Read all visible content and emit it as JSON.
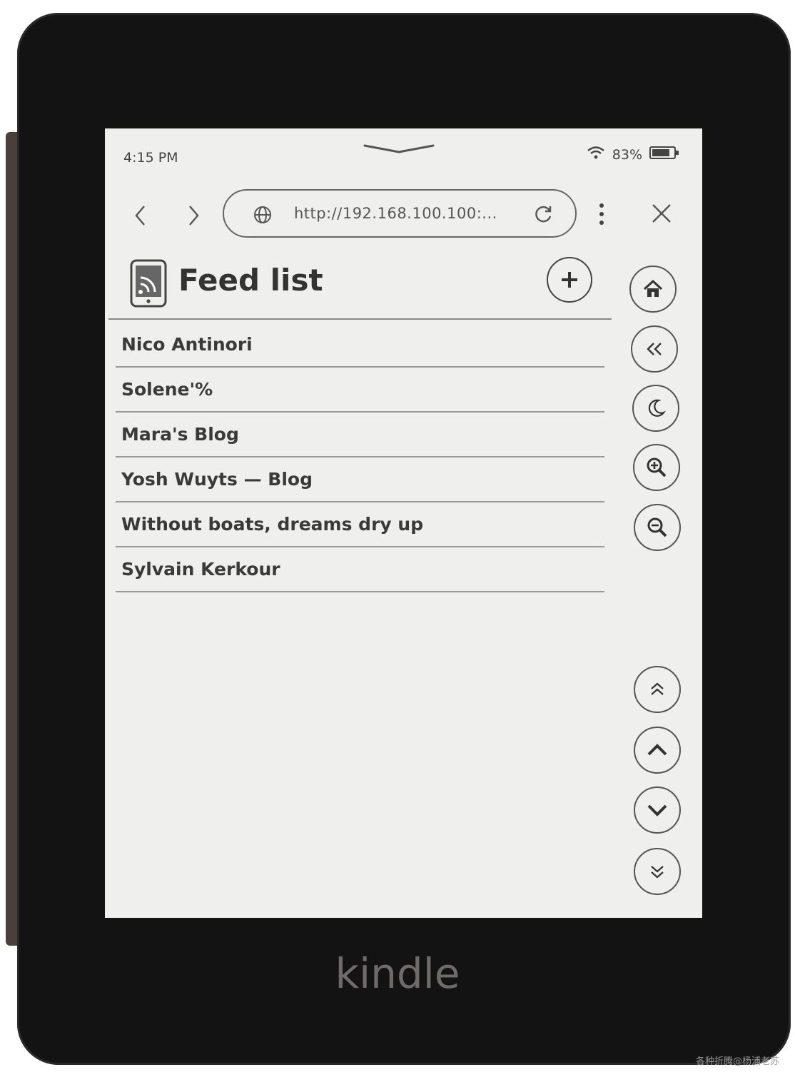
{
  "status_bar": {
    "time": "4:15 PM",
    "battery": "83%",
    "wifi_icon": "wifi-icon",
    "battery_icon": "battery-icon"
  },
  "browser": {
    "back_icon": "chevron-left-icon",
    "forward_icon": "chevron-right-icon",
    "url": "http://192.168.100.100:...",
    "globe_icon": "globe-icon",
    "reload_icon": "reload-icon",
    "menu_icon": "more-vertical-icon",
    "close_icon": "close-icon"
  },
  "page": {
    "title": "Feed list",
    "title_icon": "rss-device-icon",
    "add_icon": "plus-icon"
  },
  "feeds": [
    "Nico Antinori",
    "Solene'%",
    "Mara's Blog",
    "Yosh Wuyts — Blog",
    "Without boats, dreams dry up",
    "Sylvain Kerkour"
  ],
  "side_controls": [
    "home-icon",
    "double-chevron-left-icon",
    "moon-icon",
    "zoom-in-icon",
    "zoom-out-icon"
  ],
  "scroll_controls": [
    "double-chevron-up-icon",
    "chevron-up-icon",
    "chevron-down-icon",
    "double-chevron-down-icon"
  ],
  "device": {
    "brand": "kindle"
  },
  "watermark": "各种折腾@杨浦老苏",
  "colors": {
    "screen_bg": "#efefed",
    "bezel": "#141313",
    "ink": "#3a3a3a"
  }
}
